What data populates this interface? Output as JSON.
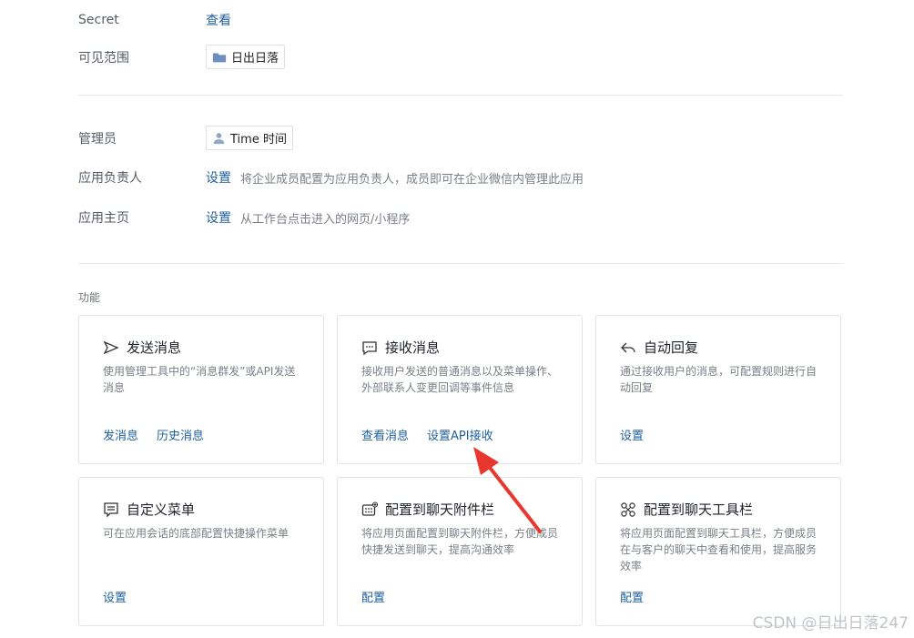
{
  "info": {
    "secret": {
      "label": "Secret",
      "action": "查看"
    },
    "visibility": {
      "label": "可见范围",
      "value": "日出日落"
    },
    "admin": {
      "label": "管理员",
      "value": "Time 时间"
    },
    "owner": {
      "label": "应用负责人",
      "action": "设置",
      "hint": "将企业成员配置为应用负责人，成员即可在企业微信内管理此应用"
    },
    "homepage": {
      "label": "应用主页",
      "action": "设置",
      "hint": "从工作台点击进入的网页/小程序"
    }
  },
  "functions": {
    "title": "功能",
    "cards": [
      {
        "icon": "send-icon",
        "title": "发送消息",
        "desc": "使用管理工具中的“消息群发”或API发送消息",
        "links": [
          "发消息",
          "历史消息"
        ]
      },
      {
        "icon": "chat-bubble-icon",
        "title": "接收消息",
        "desc": "接收用户发送的普通消息以及菜单操作、外部联系人变更回调等事件信息",
        "links": [
          "查看消息",
          "设置API接收"
        ]
      },
      {
        "icon": "reply-icon",
        "title": "自动回复",
        "desc": "通过接收用户的消息，可配置规则进行自动回复",
        "links": [
          "设置"
        ]
      },
      {
        "icon": "menu-icon",
        "title": "自定义菜单",
        "desc": "可在应用会话的底部配置快捷操作菜单",
        "links": [
          "设置"
        ]
      },
      {
        "icon": "attachment-bar-icon",
        "title": "配置到聊天附件栏",
        "desc": "将应用页面配置到聊天附件栏，方便成员快捷发送到聊天，提高沟通效率",
        "links": [
          "配置"
        ]
      },
      {
        "icon": "toolbar-icon",
        "title": "配置到聊天工具栏",
        "desc": "将应用页面配置到聊天工具栏，方便成员在与客户的聊天中查看和使用，提高服务效率",
        "links": [
          "配置"
        ]
      }
    ]
  },
  "watermark": "CSDN @日出日落247",
  "colors": {
    "link": "#1f5f9b",
    "annotation_arrow": "#e8372f"
  }
}
